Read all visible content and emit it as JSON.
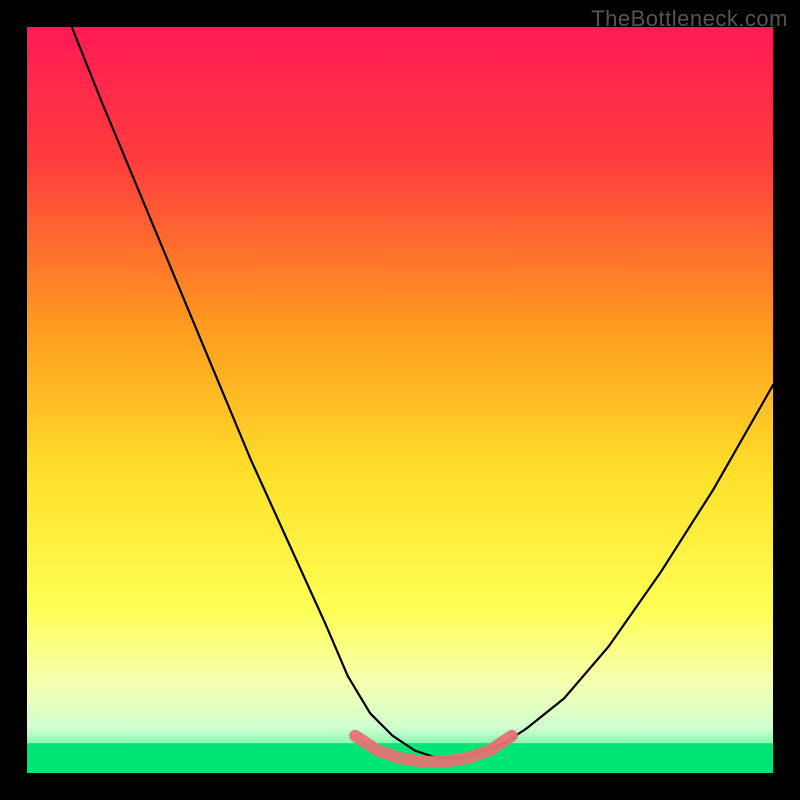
{
  "watermark": "TheBottleneck.com",
  "chart_data": {
    "type": "line",
    "title": "",
    "xlabel": "",
    "ylabel": "",
    "xlim": [
      0,
      100
    ],
    "ylim": [
      0,
      100
    ],
    "background_gradient": {
      "stops": [
        {
          "offset": 0,
          "color": "#ff1a55"
        },
        {
          "offset": 18,
          "color": "#ff3d3d"
        },
        {
          "offset": 40,
          "color": "#ff9a1f"
        },
        {
          "offset": 60,
          "color": "#ffe02a"
        },
        {
          "offset": 78,
          "color": "#ffff55"
        },
        {
          "offset": 88,
          "color": "#f5ffb0"
        },
        {
          "offset": 94,
          "color": "#d0ffd0"
        },
        {
          "offset": 100,
          "color": "#00e676"
        }
      ],
      "green_band_top": 96,
      "green_band_bottom": 100
    },
    "series": [
      {
        "name": "bottleneck-curve",
        "color": "#000000",
        "x": [
          6,
          10,
          15,
          20,
          25,
          30,
          35,
          40,
          43,
          46,
          49,
          52,
          55,
          58,
          61,
          64,
          67,
          72,
          78,
          85,
          92,
          100
        ],
        "y": [
          100,
          90,
          78,
          66,
          54,
          42,
          31,
          20,
          13,
          8,
          5,
          3,
          2,
          2,
          3,
          4,
          6,
          10,
          17,
          27,
          38,
          52
        ]
      }
    ],
    "highlight_band": {
      "name": "optimal-range",
      "color": "#e57373",
      "x": [
        44,
        47,
        50,
        53,
        56,
        59,
        62,
        65
      ],
      "y": [
        5,
        3,
        2,
        1.5,
        1.5,
        2,
        3,
        5
      ]
    }
  }
}
